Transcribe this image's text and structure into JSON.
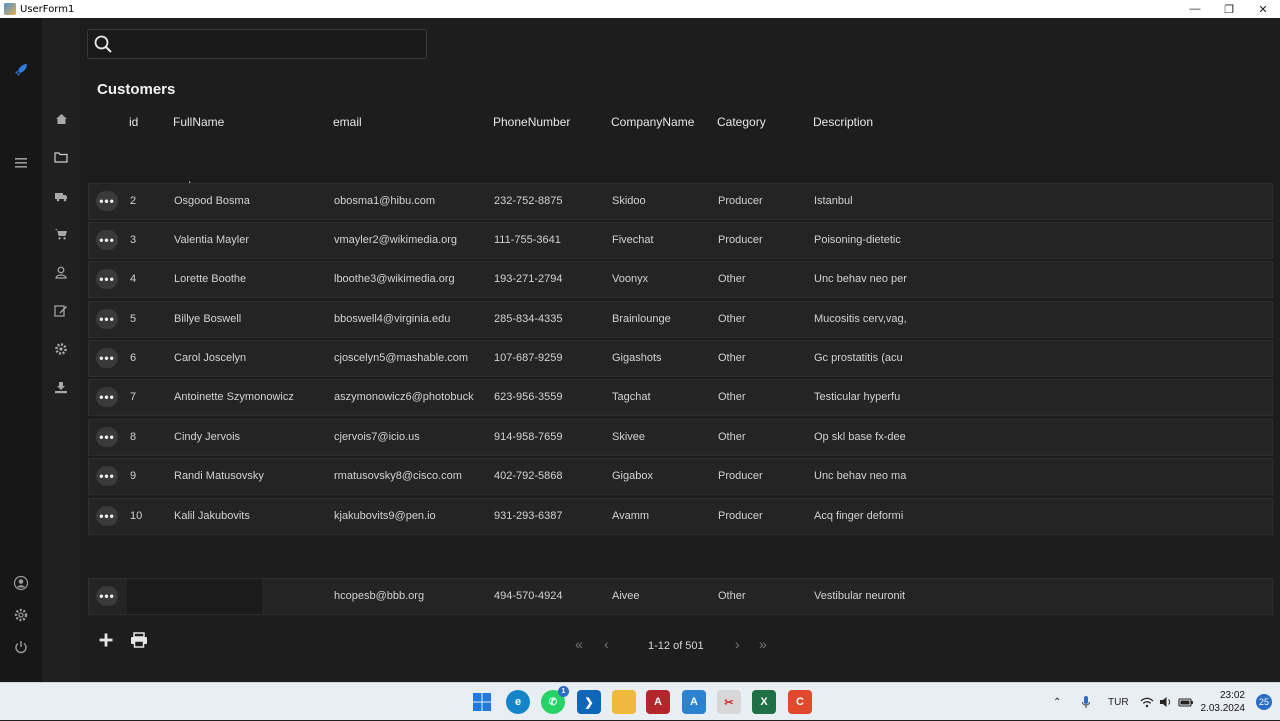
{
  "window": {
    "title": "UserForm1"
  },
  "search": {
    "placeholder": "",
    "value": ""
  },
  "page": {
    "title": "Customers"
  },
  "columns": {
    "id": "id",
    "fullname": "FullName",
    "email": "email",
    "phone": "PhoneNumber",
    "company": "CompanyName",
    "category": "Category",
    "description": "Description"
  },
  "rows": [
    {
      "id": "2",
      "name": "Osgood Bosma",
      "email": "obosma1@hibu.com",
      "phone": "232-752-8875",
      "company": "Skidoo",
      "category": "Producer",
      "description": "Istanbul"
    },
    {
      "id": "3",
      "name": "Valentia Mayler",
      "email": "vmayler2@wikimedia.org",
      "phone": "111-755-3641",
      "company": "Fivechat",
      "category": "Producer",
      "description": "Poisoning-dietetic"
    },
    {
      "id": "4",
      "name": "Lorette Boothe",
      "email": "lboothe3@wikimedia.org",
      "phone": "193-271-2794",
      "company": "Voonyx",
      "category": "Other",
      "description": "Unc behav neo per"
    },
    {
      "id": "5",
      "name": "Billye Boswell",
      "email": "bboswell4@virginia.edu",
      "phone": "285-834-4335",
      "company": "Brainlounge",
      "category": "Other",
      "description": "Mucositis cerv,vag,"
    },
    {
      "id": "6",
      "name": "Carol Joscelyn",
      "email": "cjoscelyn5@mashable.com",
      "phone": "107-687-9259",
      "company": "Gigashots",
      "category": "Other",
      "description": "Gc prostatitis (acu"
    },
    {
      "id": "7",
      "name": "Antoinette Szymonowicz",
      "email": "aszymonowicz6@photobuck",
      "phone": "623-956-3559",
      "company": "Tagchat",
      "category": "Other",
      "description": "Testicular hyperfu"
    },
    {
      "id": "8",
      "name": "Cindy Jervois",
      "email": "cjervois7@icio.us",
      "phone": "914-958-7659",
      "company": "Skivee",
      "category": "Other",
      "description": "Op skl base fx-dee"
    },
    {
      "id": "9",
      "name": "Randi Matusovsky",
      "email": "rmatusovsky8@cisco.com",
      "phone": "402-792-5868",
      "company": "Gigabox",
      "category": "Producer",
      "description": "Unc behav neo ma"
    },
    {
      "id": "10",
      "name": "Kalil Jakubovits",
      "email": "kjakubovits9@pen.io",
      "phone": "931-293-6387",
      "company": "Avamm",
      "category": "Producer",
      "description": "Acq finger deformi"
    }
  ],
  "partial_row": {
    "id": "",
    "name": "",
    "email": "hcopesb@bbb.org",
    "phone": "494-570-4924",
    "company": "Aivee",
    "category": "Other",
    "description": "Vestibular neuronit"
  },
  "pager": {
    "label": "1-12 of 501"
  },
  "taskbar": {
    "lang": "TUR",
    "time": "23:02",
    "date": "2.03.2024",
    "notifications": "25",
    "whatsapp_badge": "1"
  }
}
